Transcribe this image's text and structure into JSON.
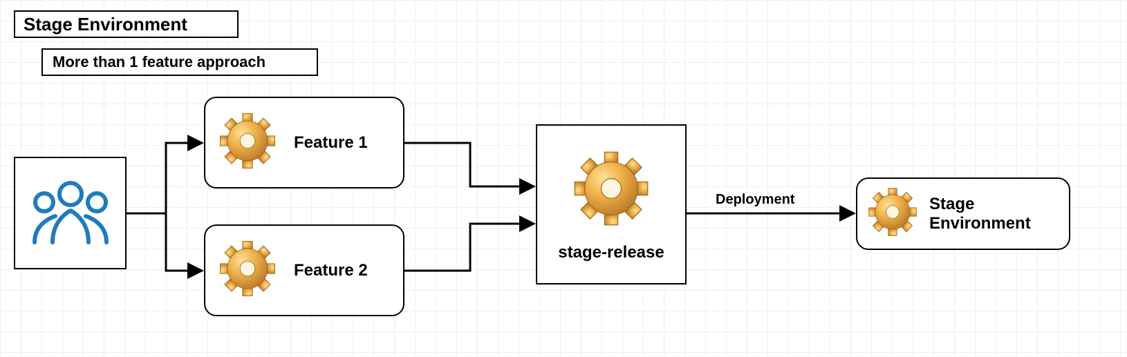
{
  "title": "Stage Environment",
  "subtitle": "More than 1 feature approach",
  "nodes": {
    "team": {
      "icon": "team-icon"
    },
    "feature1": {
      "label": "Feature 1",
      "icon": "gear-icon"
    },
    "feature2": {
      "label": "Feature 2",
      "icon": "gear-icon"
    },
    "stage_release": {
      "label": "stage-release",
      "icon": "gear-icon"
    },
    "stage_env": {
      "label_line1": "Stage",
      "label_line2": "Environment",
      "icon": "gear-icon"
    }
  },
  "edges": {
    "deployment": {
      "label": "Deployment"
    }
  },
  "colors": {
    "border": "#000000",
    "grid": "#ededed",
    "team_stroke": "#1f7bbf",
    "gear_fill": "#e8a43a",
    "gear_highlight": "#ffd777",
    "gear_shadow": "#b4742a"
  }
}
